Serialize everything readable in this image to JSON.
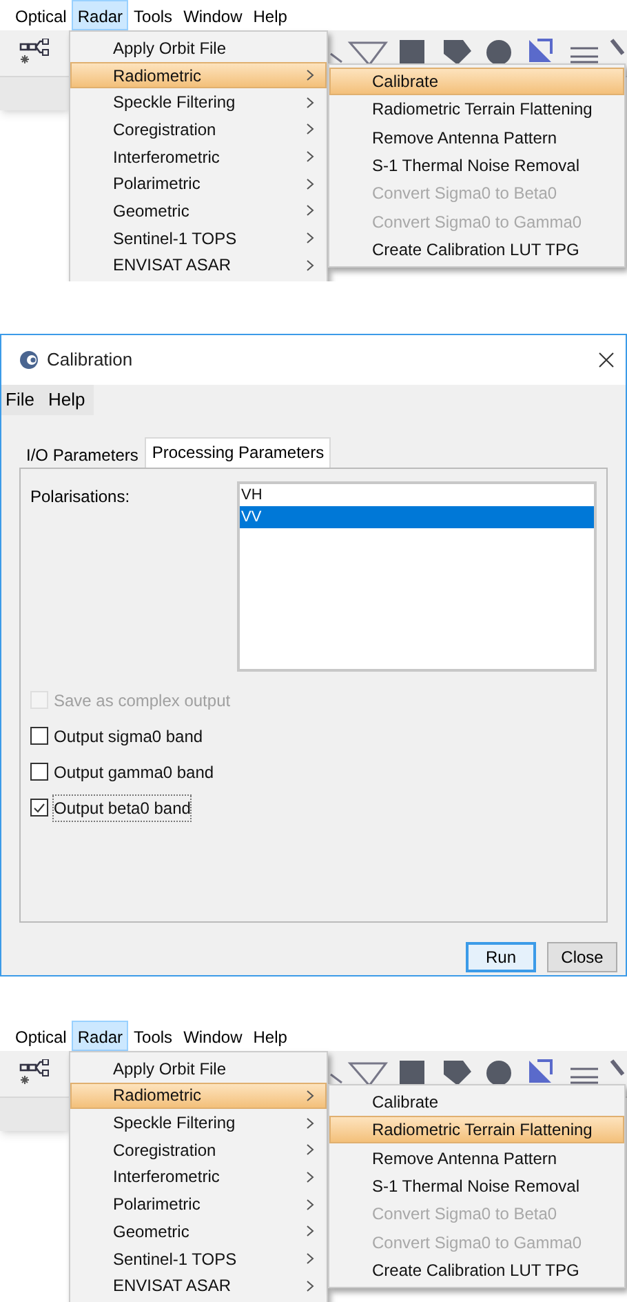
{
  "scenes": [
    {
      "menubar": [
        {
          "label": "Optical",
          "selected": false
        },
        {
          "label": "Radar",
          "selected": true
        },
        {
          "label": "Tools",
          "selected": false
        },
        {
          "label": "Window",
          "selected": false
        },
        {
          "label": "Help",
          "selected": false
        }
      ],
      "menu": [
        {
          "label": "Apply Orbit File",
          "selected": false,
          "submenu": false
        },
        {
          "label": "Radiometric",
          "selected": true,
          "submenu": true
        },
        {
          "label": "Speckle Filtering",
          "selected": false,
          "submenu": true
        },
        {
          "label": "Coregistration",
          "selected": false,
          "submenu": true
        },
        {
          "label": "Interferometric",
          "selected": false,
          "submenu": true
        },
        {
          "label": "Polarimetric",
          "selected": false,
          "submenu": true
        },
        {
          "label": "Geometric",
          "selected": false,
          "submenu": true
        },
        {
          "label": "Sentinel-1 TOPS",
          "selected": false,
          "submenu": true
        },
        {
          "label": "ENVISAT ASAR",
          "selected": false,
          "submenu": true
        }
      ],
      "submenu": [
        {
          "label": "Calibrate",
          "selected": true,
          "disabled": false
        },
        {
          "label": "Radiometric Terrain Flattening",
          "selected": false,
          "disabled": false
        },
        {
          "label": "Remove Antenna Pattern",
          "selected": false,
          "disabled": false
        },
        {
          "label": "S-1 Thermal Noise Removal",
          "selected": false,
          "disabled": false
        },
        {
          "label": "Convert Sigma0 to Beta0",
          "selected": false,
          "disabled": true
        },
        {
          "label": "Convert Sigma0 to Gamma0",
          "selected": false,
          "disabled": true
        },
        {
          "label": "Create Calibration LUT TPG",
          "selected": false,
          "disabled": false
        }
      ]
    },
    {
      "menubar": [
        {
          "label": "Optical",
          "selected": false
        },
        {
          "label": "Radar",
          "selected": true
        },
        {
          "label": "Tools",
          "selected": false
        },
        {
          "label": "Window",
          "selected": false
        },
        {
          "label": "Help",
          "selected": false
        }
      ],
      "menu": [
        {
          "label": "Apply Orbit File",
          "selected": false,
          "submenu": false
        },
        {
          "label": "Radiometric",
          "selected": true,
          "submenu": true
        },
        {
          "label": "Speckle Filtering",
          "selected": false,
          "submenu": true
        },
        {
          "label": "Coregistration",
          "selected": false,
          "submenu": true
        },
        {
          "label": "Interferometric",
          "selected": false,
          "submenu": true
        },
        {
          "label": "Polarimetric",
          "selected": false,
          "submenu": true
        },
        {
          "label": "Geometric",
          "selected": false,
          "submenu": true
        },
        {
          "label": "Sentinel-1 TOPS",
          "selected": false,
          "submenu": true
        },
        {
          "label": "ENVISAT ASAR",
          "selected": false,
          "submenu": true
        }
      ],
      "submenu": [
        {
          "label": "Calibrate",
          "selected": false,
          "disabled": false
        },
        {
          "label": "Radiometric Terrain Flattening",
          "selected": true,
          "disabled": false
        },
        {
          "label": "Remove Antenna Pattern",
          "selected": false,
          "disabled": false
        },
        {
          "label": "S-1 Thermal Noise Removal",
          "selected": false,
          "disabled": false
        },
        {
          "label": "Convert Sigma0 to Beta0",
          "selected": false,
          "disabled": true
        },
        {
          "label": "Convert Sigma0 to Gamma0",
          "selected": false,
          "disabled": true
        },
        {
          "label": "Create Calibration LUT TPG",
          "selected": false,
          "disabled": false
        }
      ]
    }
  ],
  "dialog": {
    "title": "Calibration",
    "menubar": [
      "File",
      "Help"
    ],
    "tabs": [
      {
        "label": "I/O Parameters",
        "selected": false
      },
      {
        "label": "Processing Parameters",
        "selected": true
      }
    ],
    "polarisations": {
      "label": "Polarisations:",
      "items": [
        {
          "label": "VH",
          "selected": false
        },
        {
          "label": "VV",
          "selected": true
        }
      ]
    },
    "options": [
      {
        "label": "Save as complex output",
        "checked": false,
        "disabled": true
      },
      {
        "label": "Output sigma0 band",
        "checked": false,
        "disabled": false
      },
      {
        "label": "Output gamma0 band",
        "checked": false,
        "disabled": false
      },
      {
        "label": "Output beta0 band",
        "checked": true,
        "disabled": false
      }
    ],
    "buttons": [
      {
        "label": "Run",
        "kind": "default"
      },
      {
        "label": "Close",
        "kind": "normal"
      }
    ]
  }
}
